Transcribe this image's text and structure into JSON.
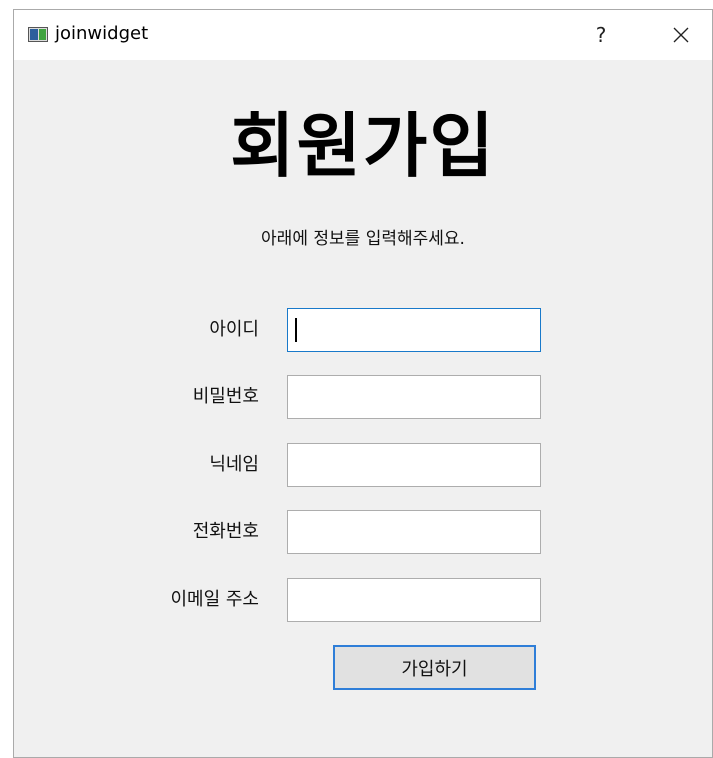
{
  "window": {
    "title": "joinwidget",
    "help_label": "?"
  },
  "form": {
    "heading": "회원가입",
    "subtitle": "아래에 정보를 입력해주세요.",
    "fields": [
      {
        "label": "아이디",
        "value": "",
        "focused": true
      },
      {
        "label": "비밀번호",
        "value": ""
      },
      {
        "label": "닉네임",
        "value": ""
      },
      {
        "label": "전화번호",
        "value": ""
      },
      {
        "label": "이메일 주소",
        "value": ""
      }
    ],
    "submit_label": "가입하기"
  },
  "colors": {
    "focus_border": "#1979ca",
    "button_border": "#2f7ed8",
    "window_bg": "#f0f0f0"
  }
}
